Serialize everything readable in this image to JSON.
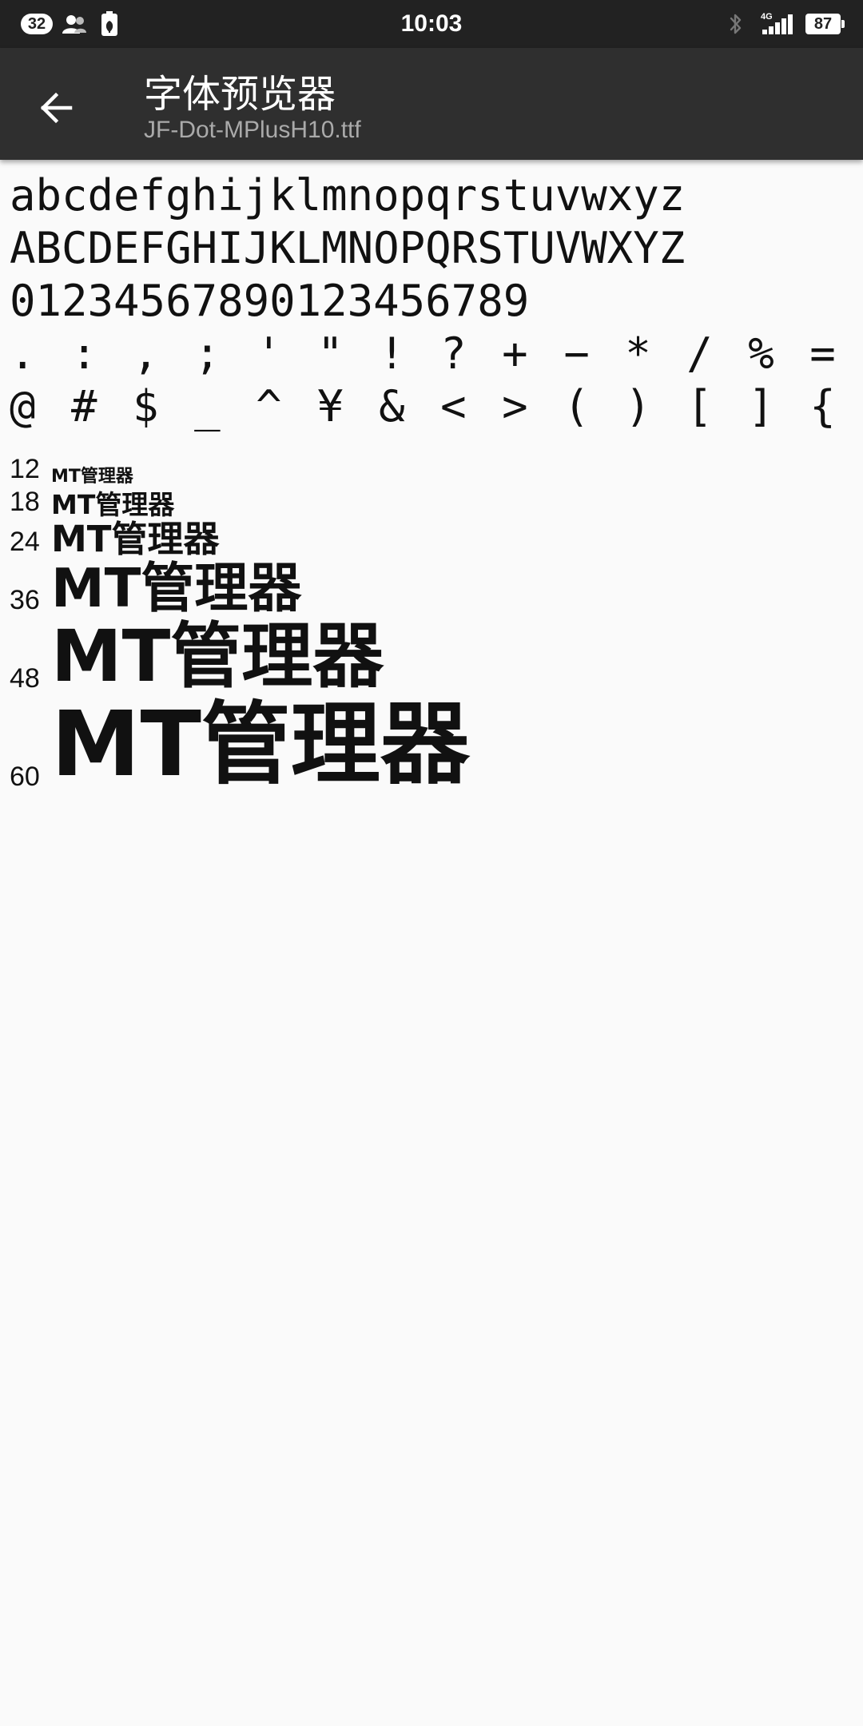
{
  "status_bar": {
    "notification_count": "32",
    "time": "10:03",
    "network_label": "4G",
    "battery": "87",
    "icons": {
      "contacts": "contacts-icon",
      "battery_saver": "battery-saver-icon",
      "bluetooth": "bluetooth-icon",
      "signal": "signal-icon"
    }
  },
  "toolbar": {
    "title": "字体预览器",
    "subtitle": "JF-Dot-MPlusH10.ttf",
    "back_icon": "arrow-back-icon"
  },
  "preview": {
    "lowercase": "abcdefghijklmnopqrstuvwxyz",
    "uppercase": "ABCDEFGHIJKLMNOPQRSTUVWXYZ",
    "digits": "01234567890123456789",
    "punctuation_1": ". : , ; ' \" ! ? + − * / % = ¯ |",
    "punctuation_2": "@ # $ _ ^ ¥ & < > ( ) [ ] { }",
    "sample_text": "MT管理器",
    "sizes": [
      {
        "label": "12",
        "size": 12
      },
      {
        "label": "18",
        "size": 18
      },
      {
        "label": "24",
        "size": 24
      },
      {
        "label": "36",
        "size": 36
      },
      {
        "label": "48",
        "size": 48
      },
      {
        "label": "60",
        "size": 60
      }
    ]
  },
  "colors": {
    "status_bar_bg": "#222222",
    "toolbar_bg": "#2f2f2f",
    "page_bg": "#fafafa",
    "text": "#111111",
    "subtitle": "#aaaaaa"
  }
}
